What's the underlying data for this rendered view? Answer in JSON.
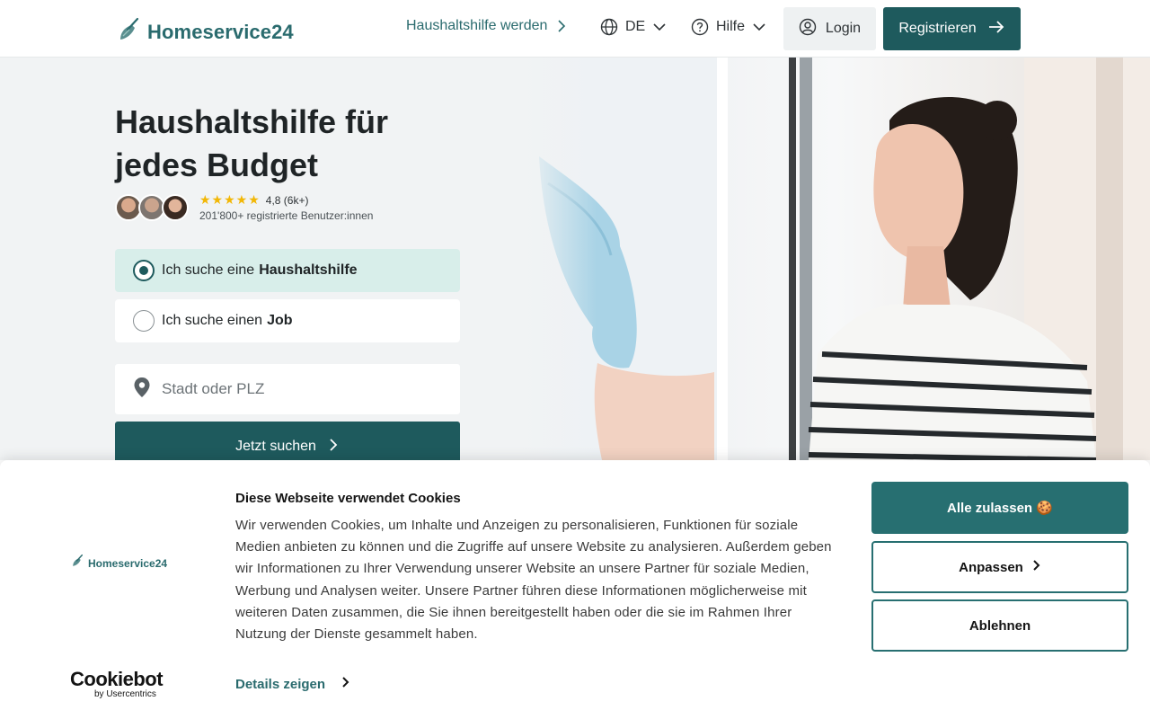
{
  "header": {
    "logo_text": "Homeservice24",
    "nav_become_helper": "Haushaltshilfe werden",
    "nav_language": "DE",
    "nav_help": "Hilfe",
    "login_label": "Login",
    "register_label": "Registrieren"
  },
  "hero": {
    "title_line1": "Haushaltshilfe für",
    "title_line2": "jedes Budget",
    "rating_value": "4,8 (6k+)",
    "registered_users": "201'800+ registrierte Benutzer:innen",
    "stars": "★★★★★",
    "choice_helper_prefix": "Ich suche eine",
    "choice_helper_bold": "Haushaltshilfe",
    "choice_job_prefix": "Ich suche einen",
    "choice_job_bold": "Job",
    "location_placeholder": "Stadt oder PLZ",
    "search_button": "Jetzt suchen"
  },
  "cookie_banner": {
    "logo_text": "Homeservice24",
    "title": "Diese Webseite verwendet Cookies",
    "body": "Wir verwenden Cookies, um Inhalte und Anzeigen zu personalisieren, Funktionen für soziale Medien anbieten zu können und die Zugriffe auf unsere Website zu analysieren. Außerdem geben wir Informationen zu Ihrer Verwendung unserer Website an unsere Partner für soziale Medien, Werbung und Analysen weiter. Unsere Partner führen diese Informationen möglicherweise mit weiteren Daten zusammen, die Sie ihnen bereitgestellt haben oder die sie im Rahmen Ihrer Nutzung der Dienste gesammelt haben.",
    "details_link": "Details zeigen",
    "allow_all": "Alle zulassen 🍪",
    "customize": "Anpassen",
    "decline": "Ablehnen",
    "provider_name": "Cookiebot",
    "provider_sub": "by Usercentrics"
  },
  "colors": {
    "brand": "#1e5a5d",
    "brand_light": "#d8eeea",
    "accent_star": "#f2b705"
  }
}
